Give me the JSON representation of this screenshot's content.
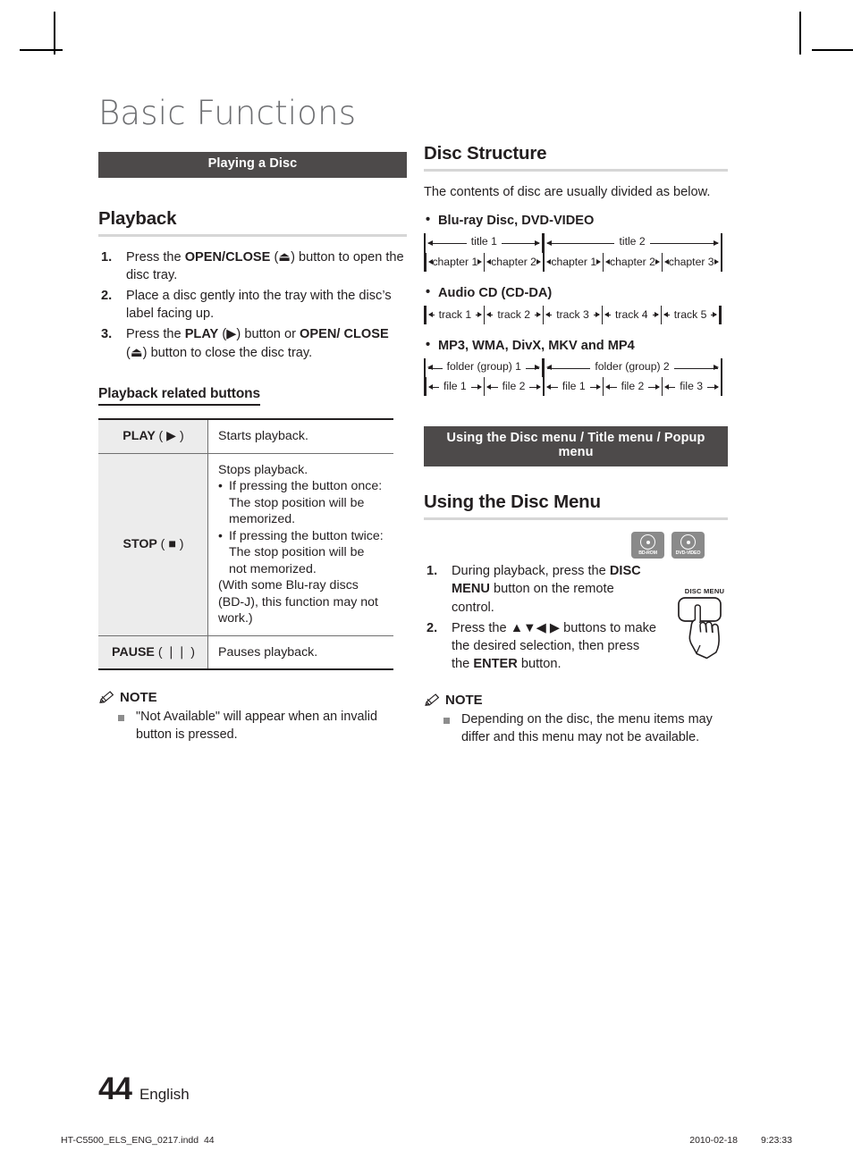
{
  "chapter": {
    "title": "Basic Functions"
  },
  "left": {
    "section_bar": "Playing a Disc",
    "heading": "Playback",
    "steps": [
      {
        "num": "1.",
        "parts": [
          {
            "t": "Press the ",
            "b": false
          },
          {
            "t": "OPEN/CLOSE",
            "b": true
          },
          {
            "t": " (⏏) button to open the disc tray.",
            "b": false
          }
        ]
      },
      {
        "num": "2.",
        "parts": [
          {
            "t": "Place a disc gently into the tray with the disc’s label facing up.",
            "b": false
          }
        ]
      },
      {
        "num": "3.",
        "parts": [
          {
            "t": "Press the ",
            "b": false
          },
          {
            "t": "PLAY",
            "b": true
          },
          {
            "t": " (▶) button or ",
            "b": false
          },
          {
            "t": "OPEN/ CLOSE",
            "b": true
          },
          {
            "t": " (⏏) button to close the disc tray.",
            "b": false
          }
        ]
      }
    ],
    "subheading": "Playback related buttons",
    "table": {
      "rows": [
        {
          "key_label": "PLAY",
          "key_glyph": "▶",
          "lead": "Starts playback.",
          "bullets": [],
          "paren": ""
        },
        {
          "key_label": "STOP",
          "key_glyph": "■",
          "lead": "Stops playback.",
          "bullets": [
            "If pressing the button once: The stop position will be memorized.",
            "If pressing the button twice: The stop position will be not memorized."
          ],
          "paren": "(With some Blu-ray discs (BD-J), this function may not work.)"
        },
        {
          "key_label": "PAUSE",
          "key_glyph": "❘❘",
          "lead": "Pauses playback.",
          "bullets": [],
          "paren": ""
        }
      ]
    },
    "note": {
      "title": "NOTE",
      "items": [
        "\"Not Available\" will appear when an invalid button is pressed."
      ]
    }
  },
  "right": {
    "heading": "Disc Structure",
    "intro": "The contents of disc are usually divided as below.",
    "groups": [
      {
        "label": "Blu-ray Disc, DVD-VIDEO",
        "top_row": [
          "title 1",
          "title 2"
        ],
        "top_spans": [
          2,
          3
        ],
        "bottom_row": [
          "chapter 1",
          "chapter 2",
          "chapter 1",
          "chapter 2",
          "chapter 3"
        ]
      },
      {
        "label": "Audio CD (CD-DA)",
        "top_row": [],
        "top_spans": [],
        "bottom_row": [
          "track 1",
          "track 2",
          "track 3",
          "track 4",
          "track 5"
        ]
      },
      {
        "label": "MP3, WMA, DivX, MKV and MP4",
        "top_row": [
          "folder (group) 1",
          "folder (group) 2"
        ],
        "top_spans": [
          2,
          3
        ],
        "bottom_row": [
          "file 1",
          "file 2",
          "file 1",
          "file 2",
          "file 3"
        ]
      }
    ],
    "section_bar": "Using the Disc menu / Title menu / Popup menu",
    "menu_heading": "Using the Disc Menu",
    "badges": [
      "BD-ROM",
      "DVD-VIDEO"
    ],
    "remote_caption": "DISC MENU",
    "steps": [
      {
        "num": "1.",
        "parts": [
          {
            "t": "During playback, press the ",
            "b": false
          },
          {
            "t": "DISC MENU",
            "b": true
          },
          {
            "t": "  button on the remote control.",
            "b": false
          }
        ]
      },
      {
        "num": "2.",
        "parts": [
          {
            "t": "Press the ▲▼◀ ▶ buttons to make the desired selection, then press the ",
            "b": false
          },
          {
            "t": "ENTER",
            "b": true
          },
          {
            "t": " button.",
            "b": false
          }
        ]
      }
    ],
    "note": {
      "title": "NOTE",
      "items": [
        "Depending on the disc, the menu items may differ and this menu may not be available."
      ]
    }
  },
  "footer": {
    "page_number": "44",
    "language": "English",
    "file_name": "HT-C5500_ELS_ENG_0217.indd",
    "file_page": "44",
    "date": "2010-02-18",
    "time": "9:23:33"
  },
  "colors": {
    "section_bar_bg": "#4d4a4a",
    "rule": "#d6d6d6",
    "table_key_bg": "#ececec",
    "badge_bg": "#8a8a8a",
    "title_gray": "#6d6e71"
  }
}
